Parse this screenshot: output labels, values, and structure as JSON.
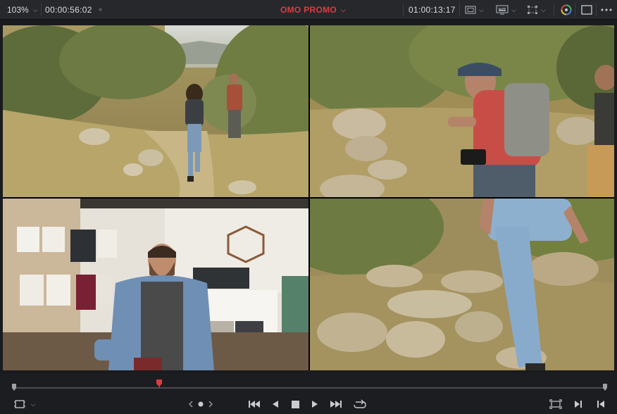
{
  "toolbar": {
    "zoom": "103%",
    "timecode_left": "00:00:56:02",
    "project_title": "OMO PROMO",
    "timecode_right": "01:00:13:17",
    "hd_badge": "HD"
  },
  "colors": {
    "accent_red": "#e23a3f",
    "bar_bg": "#26282c",
    "panel_bg": "#1c1d20"
  },
  "viewer": {
    "clips": [
      {
        "name": "hikers-on-trail-wide"
      },
      {
        "name": "hiker-with-backpack-closeup"
      },
      {
        "name": "shop-owner-interview"
      },
      {
        "name": "hiker-legs-on-rocks"
      }
    ]
  },
  "transport": {
    "playhead_fraction": 0.245,
    "icons": [
      "viewer-mode-icon",
      "jog-prev-icon",
      "jog-dot-icon",
      "jog-next-icon",
      "skip-start-icon",
      "step-back-icon",
      "stop-icon",
      "play-icon",
      "skip-end-icon",
      "loop-icon",
      "full-screen-icon",
      "next-clip-icon",
      "prev-clip-icon"
    ]
  }
}
